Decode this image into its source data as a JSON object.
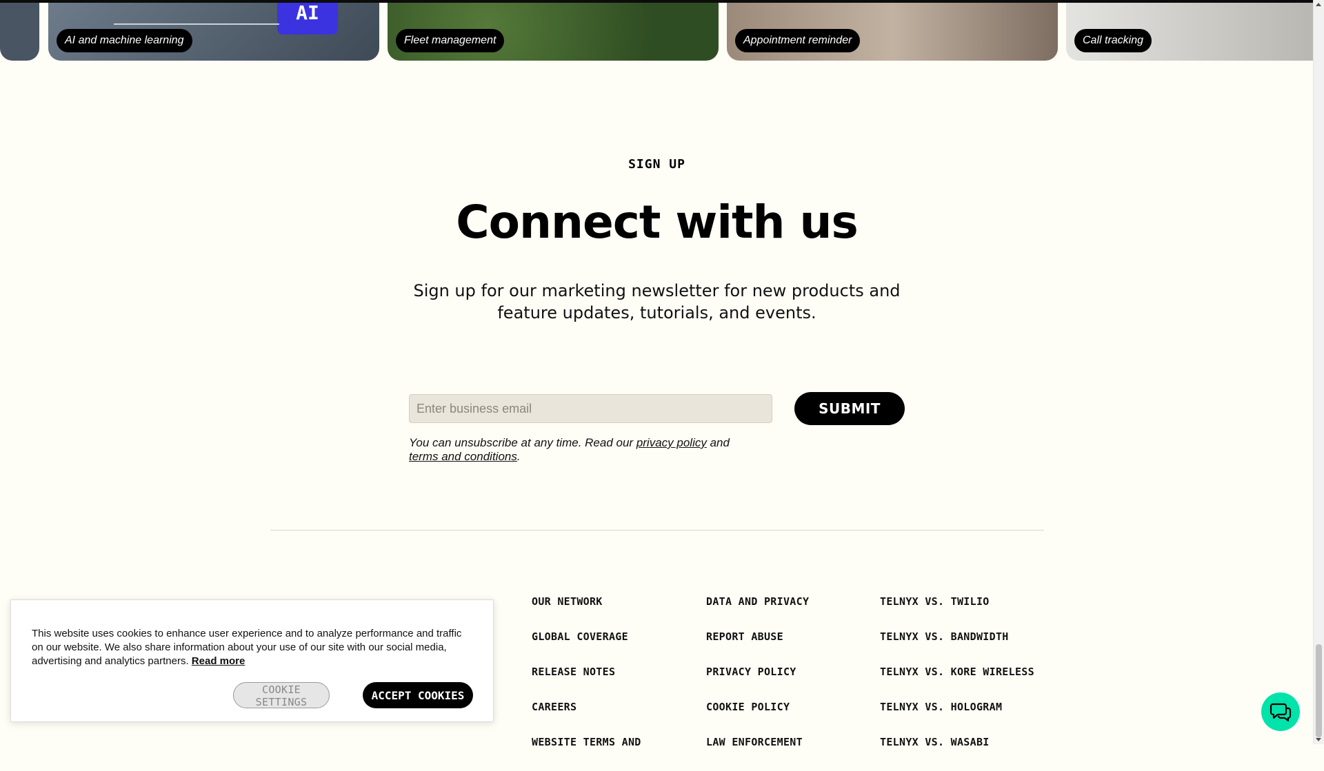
{
  "carousel": {
    "cards": [
      {
        "label": "AI and machine learning",
        "color": "#5b6a7a"
      },
      {
        "label": "Fleet management",
        "color": "#3d5f2c"
      },
      {
        "label": "Appointment reminder",
        "color": "#8e7b6c"
      },
      {
        "label": "Call tracking",
        "color": "#c9c8c3"
      }
    ],
    "ai_badge": "AI"
  },
  "signup": {
    "eyebrow": "SIGN UP",
    "headline": "Connect with us",
    "subtext": "Sign up for our marketing newsletter for new products and feature updates, tutorials, and events.",
    "email_placeholder": "Enter business email",
    "submit_label": "SUBMIT",
    "legal_prefix": "You can unsubscribe at any time. Read our ",
    "privacy_link": "privacy policy",
    "legal_mid": " and",
    "terms_link": "terms and conditions",
    "legal_suffix": "."
  },
  "footer": {
    "col1": [
      "OUR NETWORK",
      "GLOBAL COVERAGE",
      "RELEASE NOTES",
      "CAREERS",
      "WEBSITE TERMS AND"
    ],
    "col2": [
      "DATA AND PRIVACY",
      "REPORT ABUSE",
      "PRIVACY POLICY",
      "COOKIE POLICY",
      "LAW ENFORCEMENT"
    ],
    "col3": [
      "TELNYX VS. TWILIO",
      "TELNYX VS. BANDWIDTH",
      "TELNYX VS. KORE WIRELESS",
      "TELNYX VS. HOLOGRAM",
      "TELNYX VS. WASABI"
    ]
  },
  "cookie_banner": {
    "message": "This website uses cookies to enhance user experience and to analyze performance and traffic on our website. We also share information about your use of our site with our social media, advertising and analytics partners. ",
    "read_more": "Read more",
    "settings_label": "COOKIE SETTINGS",
    "accept_label": "ACCEPT COOKIES"
  },
  "chat": {
    "icon": "chat-bubbles-icon",
    "color": "#00e3aa"
  }
}
